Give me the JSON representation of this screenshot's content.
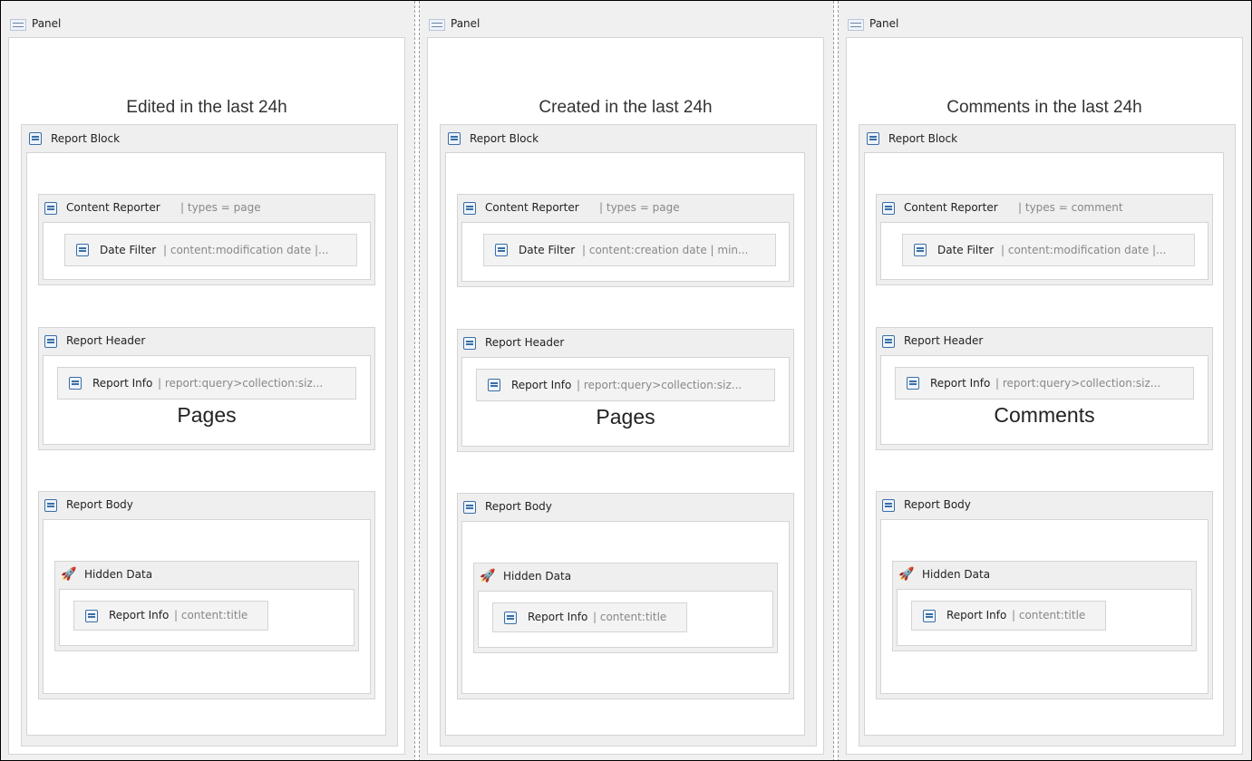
{
  "columns": [
    {
      "panel_label": "Panel",
      "title": "Edited in the last 24h",
      "report_block_label": "Report Block",
      "content_reporter": {
        "label": "Content Reporter",
        "meta": "| types = page"
      },
      "date_filter": {
        "label": "Date Filter",
        "meta": "| content:modification date |..."
      },
      "report_header_label": "Report Header",
      "header_info": {
        "label": "Report Info",
        "meta": "| report:query>collection:siz..."
      },
      "header_big": "Pages",
      "report_body_label": "Report Body",
      "hidden_data_label": "Hidden Data",
      "body_info": {
        "label": "Report Info",
        "meta": "| content:title"
      }
    },
    {
      "panel_label": "Panel",
      "title": "Created in the last 24h",
      "report_block_label": "Report Block",
      "content_reporter": {
        "label": "Content Reporter",
        "meta": "| types = page"
      },
      "date_filter": {
        "label": "Date Filter",
        "meta": "| content:creation date | min..."
      },
      "report_header_label": "Report Header",
      "header_info": {
        "label": "Report Info",
        "meta": "| report:query>collection:siz..."
      },
      "header_big": "Pages",
      "report_body_label": "Report Body",
      "hidden_data_label": "Hidden Data",
      "body_info": {
        "label": "Report Info",
        "meta": "| content:title"
      }
    },
    {
      "panel_label": "Panel",
      "title": "Comments in the last 24h",
      "report_block_label": "Report Block",
      "content_reporter": {
        "label": "Content Reporter",
        "meta": "| types = comment"
      },
      "date_filter": {
        "label": "Date Filter",
        "meta": "| content:modification date |..."
      },
      "report_header_label": "Report Header",
      "header_info": {
        "label": "Report Info",
        "meta": "| report:query>collection:siz..."
      },
      "header_big": "Comments",
      "report_body_label": "Report Body",
      "hidden_data_label": "Hidden Data",
      "body_info": {
        "label": "Report Info",
        "meta": "| content:title"
      }
    }
  ],
  "icons": {
    "panel": "panel-icon",
    "block": "report-block-icon",
    "hidden": "rocket-icon"
  }
}
